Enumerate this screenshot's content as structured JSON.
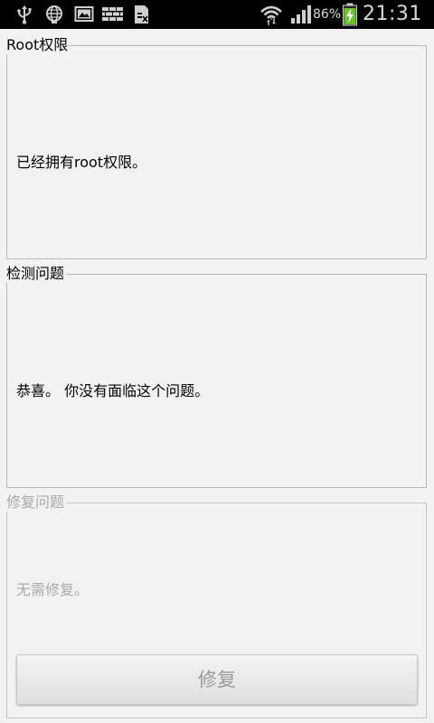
{
  "status_bar": {
    "notification_icons": [
      "usb-icon",
      "globe-icon",
      "screenshot-icon",
      "keyboard-icon",
      "sd-card-icon"
    ],
    "system_icons": [
      "wifi-icon",
      "signal-icon",
      "battery-charging-icon"
    ],
    "battery_text": "86%",
    "time": "21:31"
  },
  "sections": [
    {
      "legend": "Root权限",
      "message": "已经拥有root权限。",
      "enabled": true
    },
    {
      "legend": "检测问题",
      "message": "恭喜。 你没有面临这个问题。",
      "enabled": true
    },
    {
      "legend": "修复问题",
      "message": "无需修复。",
      "enabled": false,
      "button_label": "修复"
    }
  ],
  "colors": {
    "background": "#f2f2f2",
    "status_bar": "#000000",
    "text": "#000000",
    "disabled_text": "#aaaaaa",
    "battery_fill": "#6cc02a"
  }
}
